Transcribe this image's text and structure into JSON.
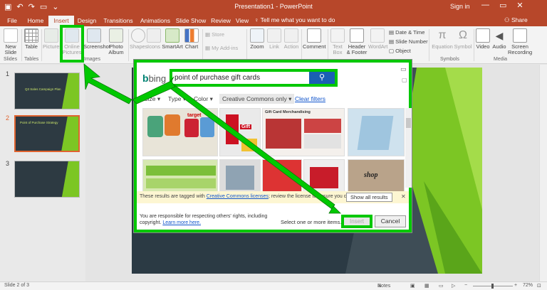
{
  "titlebar": {
    "title": "Presentation1 - PowerPoint",
    "signin": "Sign in",
    "qat_icons": [
      "save-icon",
      "undo-icon",
      "redo-icon",
      "slideshow-start-icon",
      "customize-icon"
    ],
    "minimize": "—",
    "restore": "▭",
    "close": "✕"
  },
  "tabs": {
    "items": [
      "File",
      "Home",
      "Insert",
      "Design",
      "Transitions",
      "Animations",
      "Slide Show",
      "Review",
      "View"
    ],
    "active": "Insert",
    "tellme": "Tell me what you want to do",
    "share": "Share"
  },
  "ribbon": {
    "new_slide": "New Slide",
    "table": "Table",
    "pictures": "Pictures",
    "online_pictures": "Online Pictures",
    "screenshot": "Screenshot",
    "photo_album": "Photo Album",
    "shapes": "Shapes",
    "icons": "Icons",
    "smartart": "SmartArt",
    "chart": "Chart",
    "store": "Store",
    "my_addins": "My Add-ins",
    "zoom": "Zoom",
    "link": "Link",
    "action": "Action",
    "comment": "Comment",
    "text_box": "Text Box",
    "header_footer": "Header & Footer",
    "wordart": "WordArt",
    "date_time": "Date & Time",
    "slide_number": "Slide Number",
    "object": "Object",
    "equation": "Equation",
    "symbol": "Symbol",
    "video": "Video",
    "audio": "Audio",
    "screen_recording": "Screen Recording",
    "groups": {
      "slides": "Slides",
      "tables": "Tables",
      "images": "Images",
      "symbols": "Symbols",
      "media": "Media"
    }
  },
  "thumbnails": {
    "items": [
      {
        "number": "1",
        "title": "Q3 Sales Campaign Plan"
      },
      {
        "number": "2",
        "title": "Point of Purchase Strategy"
      },
      {
        "number": "3",
        "title": ""
      }
    ]
  },
  "dialog": {
    "logo": "bing",
    "search_value": "point of purchase gift cards",
    "filters": {
      "size": "Size",
      "type": "Type",
      "color": "Color",
      "license": "Creative Commons only",
      "clear": "Clear filters"
    },
    "results": [
      {
        "label": "target",
        "color": "#e8e4d8"
      },
      {
        "label": "Gift",
        "color": "#eaeaea"
      },
      {
        "label": "Gift Card Merchandising",
        "color": "#f4f0ec"
      },
      {
        "label": "shop",
        "color": "#cfe2ee"
      }
    ],
    "notice": {
      "prefix": "These results are tagged with ",
      "link": "Creative Commons licenses",
      "suffix": "; review the license to ensure you comply.",
      "show_all": "Show all results"
    },
    "footer": {
      "text": "You are responsible for respecting others' rights, including copyright.",
      "link": "Learn more here.",
      "select": "Select one or more items.",
      "insert": "Insert",
      "cancel": "Cancel"
    }
  },
  "status": {
    "slide": "Slide 2 of 3",
    "notes": "Notes",
    "zoom": "72%"
  },
  "colors": {
    "accent": "#b7472a",
    "highlight": "#00c800",
    "slide_bg": "#2b3a44",
    "slide_green": "#7cc624",
    "bing_blue": "#1a5fb4"
  }
}
